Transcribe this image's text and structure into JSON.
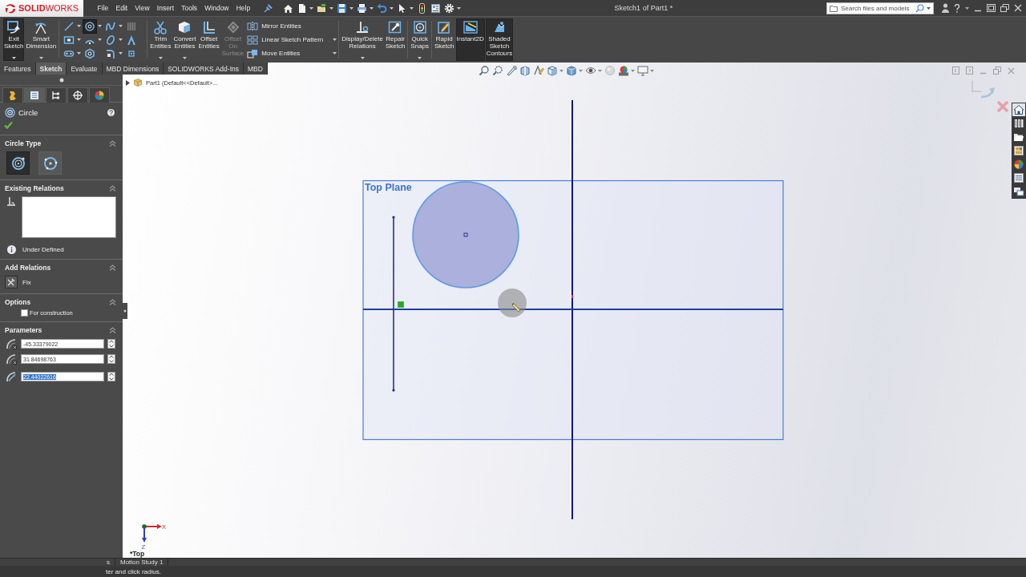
{
  "title_bar": {
    "logo": "**SOLID**WORKS",
    "menu": [
      "File",
      "Edit",
      "View",
      "Insert",
      "Tools",
      "Window",
      "Help"
    ],
    "title": "Sketch1 of Part1 *",
    "search": {
      "placeholder": "Search files and models"
    }
  },
  "command_manager": {
    "groups": [
      {
        "kind": "buttons",
        "buttons": [
          {
            "label": "Exit Sketch",
            "on": true,
            "disabled": false,
            "dropdown": true
          },
          {
            "label": "Smart Dimension",
            "on": false,
            "disabled": false,
            "dropdown": true
          }
        ]
      },
      {
        "kind": "tool_grid",
        "tools": [
          {
            "on": false,
            "disabled": false,
            "dropdown": true
          },
          {
            "on": true,
            "disabled": false,
            "dropdown": true
          },
          {
            "on": false,
            "disabled": false,
            "dropdown": true
          },
          {
            "on": false,
            "disabled": true,
            "dropdown": false
          },
          {
            "on": false,
            "disabled": false,
            "dropdown": true
          },
          {
            "on": false,
            "disabled": false,
            "dropdown": true
          },
          {
            "on": false,
            "disabled": false,
            "dropdown": true
          },
          {
            "on": false,
            "disabled": false,
            "dropdown": false
          },
          {
            "on": false,
            "disabled": false,
            "dropdown": true
          },
          {
            "on": false,
            "disabled": false,
            "dropdown": false
          },
          {
            "on": false,
            "disabled": false,
            "dropdown": true
          },
          {
            "on": false,
            "disabled": false,
            "dropdown": false
          }
        ]
      },
      {
        "kind": "buttons",
        "buttons": [
          {
            "label": "Trim Entities",
            "on": false,
            "disabled": false,
            "dropdown": true
          },
          {
            "label": "Convert Entities",
            "on": false,
            "disabled": false,
            "dropdown": true
          },
          {
            "label": "Offset Entities",
            "on": false,
            "disabled": false,
            "dropdown": false
          },
          {
            "label": "Offset On Surface",
            "on": false,
            "disabled": true,
            "dropdown": false
          }
        ],
        "list": [
          {
            "label": "Mirror Entities",
            "dropdown": false
          },
          {
            "label": "Linear Sketch Pattern",
            "dropdown": true
          },
          {
            "label": "Move Entities",
            "dropdown": true
          }
        ]
      },
      {
        "kind": "buttons",
        "buttons": [
          {
            "label": "Display/Delete Relations",
            "on": false,
            "disabled": false,
            "dropdown": true
          },
          {
            "label": "Repair Sketch",
            "on": false,
            "disabled": false,
            "dropdown": false
          }
        ]
      },
      {
        "kind": "buttons",
        "buttons": [
          {
            "label": "Quick Snaps",
            "on": false,
            "disabled": false,
            "dropdown": true
          }
        ]
      },
      {
        "kind": "buttons",
        "buttons": [
          {
            "label": "Rapid Sketch",
            "on": false,
            "disabled": false,
            "dropdown": false
          },
          {
            "label": "Instant2D",
            "on": true,
            "disabled": false,
            "dropdown": false
          },
          {
            "label": "Shaded Sketch Contours",
            "on": true,
            "disabled": false,
            "dropdown": false
          }
        ]
      }
    ]
  },
  "command_tabs": [
    {
      "label": "Features",
      "selected": false
    },
    {
      "label": "Sketch",
      "selected": true
    },
    {
      "label": "Evaluate",
      "selected": false
    },
    {
      "label": "MBD Dimensions",
      "selected": false
    },
    {
      "label": "SOLIDWORKS Add-Ins",
      "selected": false
    },
    {
      "label": "MBD",
      "selected": false
    }
  ],
  "panel_tabs": [
    {
      "selected": false
    },
    {
      "selected": true
    },
    {
      "selected": false
    },
    {
      "selected": false
    },
    {
      "selected": false
    }
  ],
  "property_manager": {
    "title": "Circle",
    "sections": [
      {
        "kind": "circle_type",
        "title": "Circle Type",
        "expanded": true,
        "options": [
          {
            "selected": true
          },
          {
            "selected": false
          }
        ]
      },
      {
        "kind": "relations",
        "title": "Existing Relations",
        "expanded": true,
        "status": "Under Defined"
      },
      {
        "kind": "add_relations",
        "title": "Add Relations",
        "expanded": true,
        "items": [
          "Fix"
        ]
      },
      {
        "kind": "options",
        "title": "Options",
        "expanded": true,
        "checkboxes": [
          {
            "label": "For construction",
            "checked": false
          }
        ]
      },
      {
        "kind": "parameters",
        "title": "Parameters",
        "expanded": true,
        "fields": [
          {
            "value": "-45.33379022",
            "selected": false
          },
          {
            "value": "31.84698763",
            "selected": false
          },
          {
            "value": "22.44022616",
            "selected": true
          }
        ]
      }
    ]
  },
  "graphics": {
    "tree_item": "Part1 (Default<<Default>...",
    "plane_label": "Top Plane",
    "triad": {
      "x_label": "X",
      "z_label": "Z"
    },
    "view_label": "*Top"
  },
  "task_pane": [
    {
      "selected": true
    },
    {
      "selected": false
    },
    {
      "selected": false
    },
    {
      "selected": false
    },
    {
      "selected": false
    },
    {
      "selected": false
    },
    {
      "selected": false
    }
  ],
  "bottom_tabs": [
    "s",
    "Motion Study 1"
  ],
  "status_bar": {
    "message": "ter and click radius."
  }
}
